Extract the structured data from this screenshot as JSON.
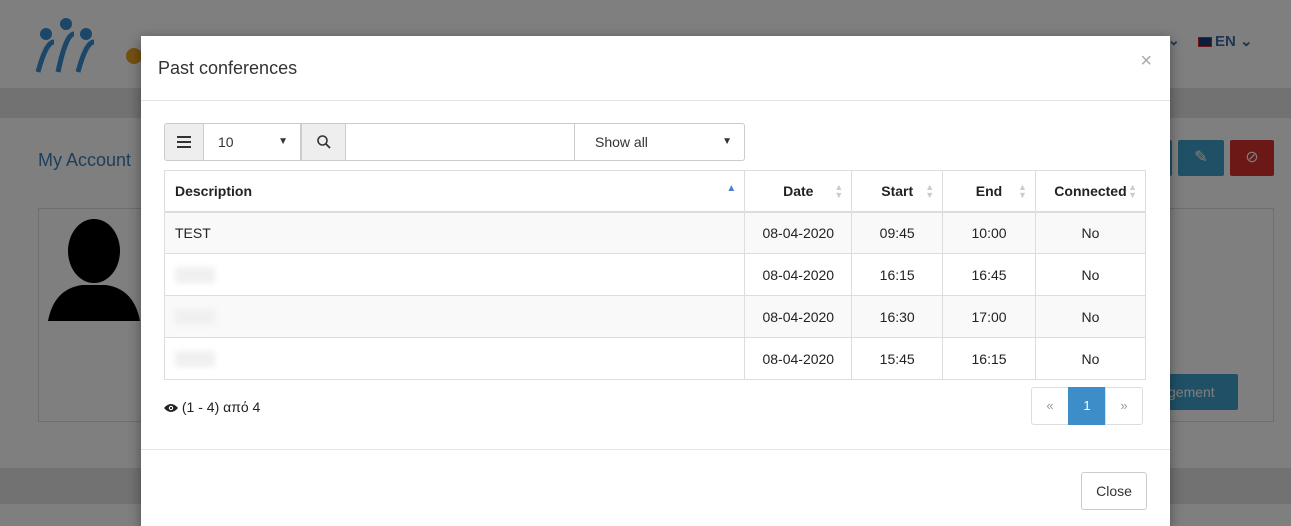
{
  "background": {
    "language": "EN",
    "my_account": "My Account",
    "management_button": "gement"
  },
  "modal": {
    "title": "Past conferences",
    "close_x": "×",
    "toolbar": {
      "page_length": "10",
      "search_placeholder": "",
      "filter": "Show all"
    },
    "table": {
      "headers": {
        "description": "Description",
        "date": "Date",
        "start": "Start",
        "end": "End",
        "connected": "Connected"
      },
      "rows": [
        {
          "description": "TEST",
          "date": "08-04-2020",
          "start": "09:45",
          "end": "10:00",
          "connected": "No"
        },
        {
          "description": "",
          "date": "08-04-2020",
          "start": "16:15",
          "end": "16:45",
          "connected": "No"
        },
        {
          "description": "",
          "date": "08-04-2020",
          "start": "16:30",
          "end": "17:00",
          "connected": "No"
        },
        {
          "description": "",
          "date": "08-04-2020",
          "start": "15:45",
          "end": "16:15",
          "connected": "No"
        }
      ]
    },
    "info": "(1 - 4) από 4",
    "pagination": {
      "prev": "«",
      "current": "1",
      "next": "»"
    },
    "close_button": "Close"
  },
  "colors": {
    "accent": "#3c8dc8",
    "danger": "#d9302c",
    "link": "#3a7fb8"
  }
}
